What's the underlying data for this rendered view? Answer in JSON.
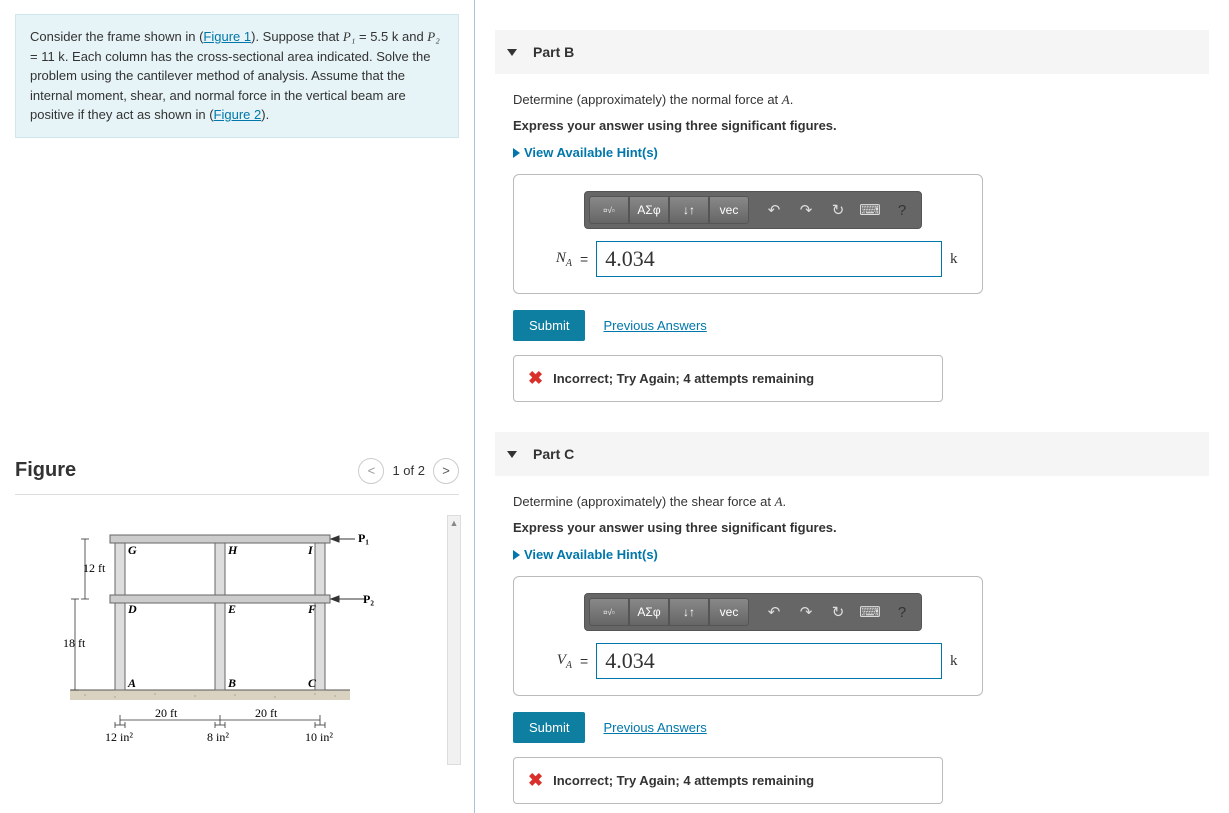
{
  "problem": {
    "text_before_fig1": "Consider the frame shown in (",
    "fig1_link": "Figure 1",
    "text_mid1": "). Suppose that ",
    "P1_var": "P₁",
    "P1_val": " = 5.5 k",
    "text_mid2": " and ",
    "P2_var": "P₂",
    "P2_val": " = 11 k",
    "text_mid3": ". Each column has the cross-sectional area indicated. Solve the problem using the cantilever method of analysis. Assume that the internal moment, shear, and normal force in the vertical beam are positive if they act as shown in (",
    "fig2_link": "Figure 2",
    "text_end": ")."
  },
  "figure": {
    "title": "Figure",
    "nav_count": "1 of 2",
    "labels": {
      "h1": "12 ft",
      "h2": "18 ft",
      "w1": "20 ft",
      "w2": "20 ft",
      "a1": "12 in²",
      "a2": "8 in²",
      "a3": "10 in²",
      "G": "G",
      "H": "H",
      "I": "I",
      "D": "D",
      "E": "E",
      "F": "F",
      "A": "A",
      "B": "B",
      "C": "C",
      "P1": "P₁",
      "P2": "P₂"
    }
  },
  "partB": {
    "title": "Part B",
    "prompt1": "Determine (approximately) the normal force at ",
    "point": "A",
    "prompt2": "Express your answer using three significant figures.",
    "hints": "View Available Hint(s)",
    "toolbar": {
      "greek": "ΑΣφ",
      "vec": "vec",
      "help": "?"
    },
    "var_html": "N",
    "var_sub": "A",
    "value": "4.034",
    "unit": "k",
    "submit": "Submit",
    "prev": "Previous Answers",
    "feedback": "Incorrect; Try Again; 4 attempts remaining"
  },
  "partC": {
    "title": "Part C",
    "prompt1": "Determine (approximately) the shear force at ",
    "point": "A",
    "prompt2": "Express your answer using three significant figures.",
    "hints": "View Available Hint(s)",
    "toolbar": {
      "greek": "ΑΣφ",
      "vec": "vec",
      "help": "?"
    },
    "var_html": "V",
    "var_sub": "A",
    "value": "4.034",
    "unit": "k",
    "submit": "Submit",
    "prev": "Previous Answers",
    "feedback": "Incorrect; Try Again; 4 attempts remaining"
  }
}
